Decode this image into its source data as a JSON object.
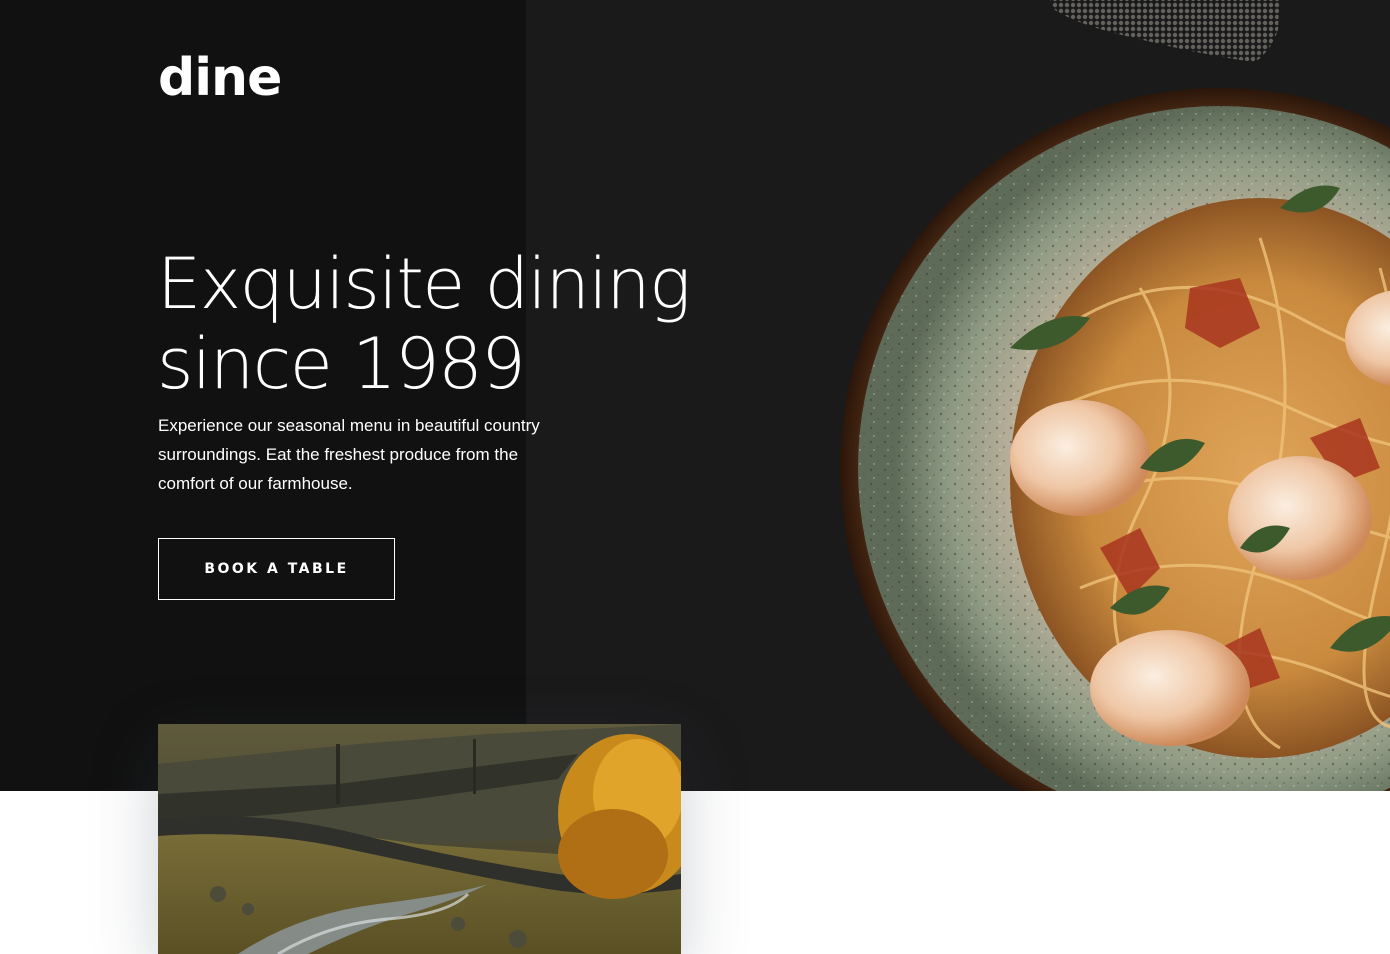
{
  "brand": {
    "logo_text": "dine"
  },
  "hero": {
    "headline_line1": "Exquisite dining",
    "headline_line2": "since 1989",
    "description_line1": "Experience our seasonal menu in beautiful country",
    "description_line2": "surroundings. Eat the freshest produce from the",
    "description_line3": "comfort of our farmhouse.",
    "cta_label": "BOOK A TABLE"
  },
  "images": {
    "hero_dish": "pasta-with-shrimp-plate-image",
    "farm_landscape": "countryside-stream-landscape-image",
    "decoration": "pattern-lines-decoration"
  },
  "colors": {
    "hero_background": "#1b1a1b",
    "hero_panel": "#111111",
    "text_light": "#ffffff",
    "page_background": "#ffffff"
  }
}
